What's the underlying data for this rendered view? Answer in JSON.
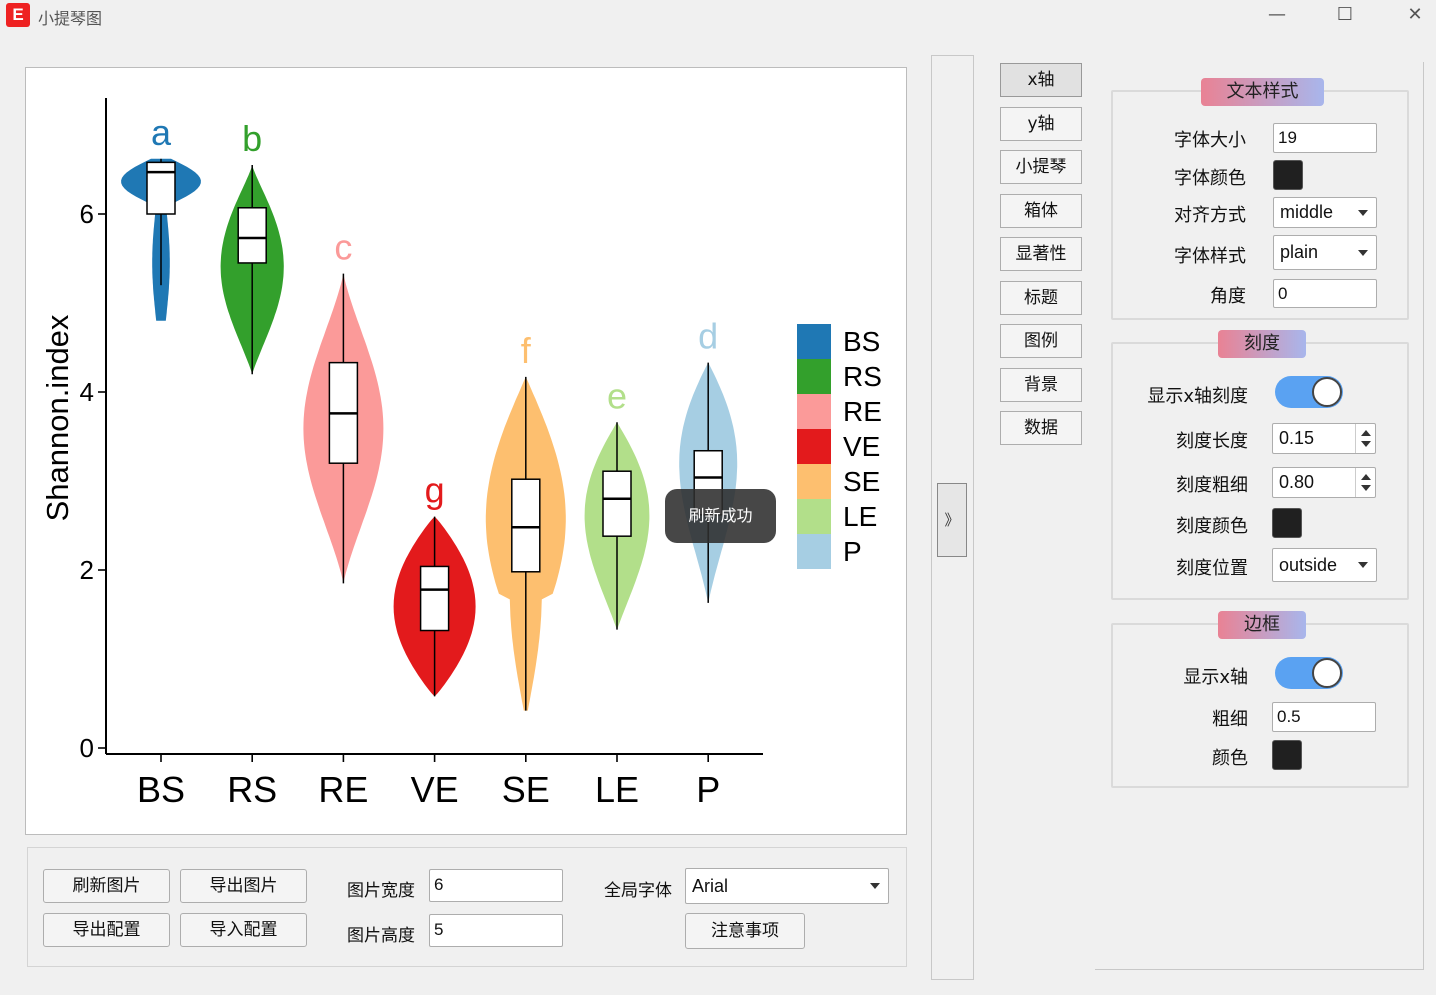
{
  "window": {
    "icon_letter": "E",
    "title": "小提琴图",
    "controls": {
      "minimize": "—",
      "maximize": "☐",
      "close": "✕"
    }
  },
  "chart_data": {
    "type": "violin",
    "ylabel": "Shannon.index",
    "xlabel": "",
    "ylim": [
      0,
      7
    ],
    "yticks": [
      0,
      2,
      4,
      6
    ],
    "categories": [
      "BS",
      "RS",
      "RE",
      "VE",
      "SE",
      "LE",
      "P"
    ],
    "colors": [
      "#1f78b4",
      "#33a02c",
      "#fb9a99",
      "#e31a1c",
      "#fdbf6f",
      "#b2df8a",
      "#a6cee3"
    ],
    "significance_letters": [
      "a",
      "b",
      "c",
      "g",
      "f",
      "e",
      "d"
    ],
    "box": {
      "min": [
        5.2,
        4.2,
        1.85,
        0.58,
        0.42,
        1.33,
        1.63
      ],
      "q1": [
        6.0,
        5.45,
        3.2,
        1.32,
        1.98,
        2.38,
        2.62
      ],
      "median": [
        6.47,
        5.73,
        3.76,
        1.78,
        2.48,
        2.8,
        3.04
      ],
      "q3": [
        6.58,
        6.07,
        4.33,
        2.04,
        3.02,
        3.11,
        3.34
      ],
      "max": [
        6.62,
        6.55,
        5.33,
        2.6,
        4.17,
        3.66,
        4.33
      ]
    },
    "legend": {
      "position": "right",
      "entries": [
        "BS",
        "RS",
        "RE",
        "VE",
        "SE",
        "LE",
        "P"
      ]
    }
  },
  "toast": {
    "text": "刷新成功"
  },
  "bottom": {
    "refresh_button": "刷新图片",
    "export_image_button": "导出图片",
    "export_config_button": "导出配置",
    "import_config_button": "导入配置",
    "width_label": "图片宽度",
    "width_value": "6",
    "height_label": "图片高度",
    "height_value": "5",
    "font_label": "全局字体",
    "font_value": "Arial",
    "notes_button": "注意事项"
  },
  "collapse_button": "》",
  "nav": [
    "x轴",
    "y轴",
    "小提琴",
    "箱体",
    "显著性",
    "标题",
    "图例",
    "背景",
    "数据"
  ],
  "settings": {
    "text_style": {
      "title": "文本样式",
      "font_size_label": "字体大小",
      "font_size_value": "19",
      "font_color_label": "字体颜色",
      "font_color": "#202020",
      "align_label": "对齐方式",
      "align_value": "middle",
      "style_label": "字体样式",
      "style_value": "plain",
      "angle_label": "角度",
      "angle_value": "0"
    },
    "ticks": {
      "title": "刻度",
      "show_label": "显示x轴刻度",
      "show_on": true,
      "length_label": "刻度长度",
      "length_value": "0.15",
      "width_label": "刻度粗细",
      "width_value": "0.80",
      "color_label": "刻度颜色",
      "color": "#202020",
      "position_label": "刻度位置",
      "position_value": "outside"
    },
    "border": {
      "title": "边框",
      "show_label": "显示x轴",
      "show_on": true,
      "width_label": "粗细",
      "width_value": "0.5",
      "color_label": "颜色",
      "color": "#202020"
    }
  }
}
